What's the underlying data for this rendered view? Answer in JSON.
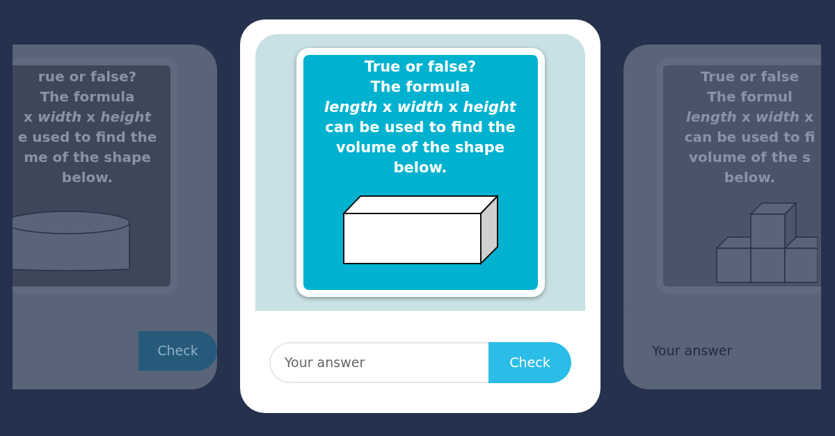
{
  "cards": [
    {
      "kind": "side",
      "figure": {
        "kind": "cylinder"
      },
      "question_lines": [
        "rue or false?",
        "The formula",
        "x *width* x *height*",
        "e used to find the",
        "me of the shape",
        "below."
      ],
      "button": "Check"
    },
    {
      "kind": "main",
      "figure": {
        "kind": "cuboid"
      },
      "question_lines": [
        "True or false?",
        "The formula",
        "*length* x *width* x *height*",
        "can be used to find the",
        "volume of the shape",
        "below."
      ],
      "answer_placeholder": "Your answer",
      "button": "Check"
    },
    {
      "kind": "side",
      "figure": {
        "kind": "cubes"
      },
      "question_lines": [
        "True or false",
        "The formul",
        "*length* x *width* x",
        "can be used to fi",
        "volume of the s",
        "below."
      ],
      "answer_placeholder": "Your answer"
    }
  ]
}
